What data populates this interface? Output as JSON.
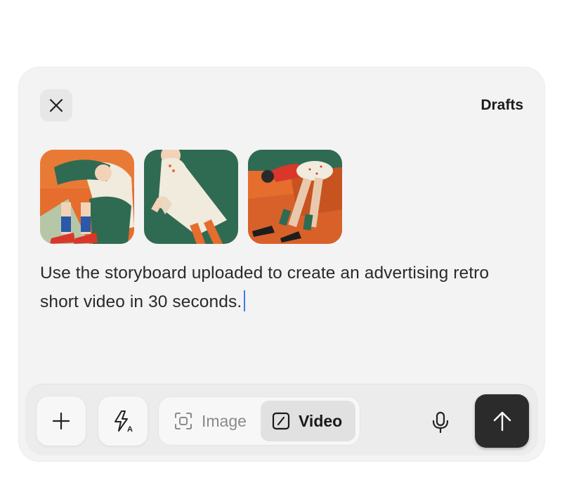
{
  "header": {
    "close_icon": "close-icon",
    "drafts_label": "Drafts"
  },
  "attachments": [
    {
      "name": "storyboard-image-1",
      "colors": [
        "#e56d2d",
        "#2f6b52",
        "#f1ebdd"
      ]
    },
    {
      "name": "storyboard-image-2",
      "colors": [
        "#2f6b52",
        "#f1ebdd",
        "#e56d2d"
      ]
    },
    {
      "name": "storyboard-image-3",
      "colors": [
        "#e56d2d",
        "#2f6b52",
        "#f1ebdd"
      ]
    }
  ],
  "prompt": {
    "text": "Use the storyboard uploaded to create an advertising retro short video in 30 seconds."
  },
  "toolbar": {
    "add_icon": "plus-icon",
    "magic_icon": "sparkle-bolt-icon",
    "modes": [
      {
        "label": "Image",
        "icon": "scan-image-icon",
        "selected": false
      },
      {
        "label": "Video",
        "icon": "video-frame-icon",
        "selected": true
      }
    ],
    "mic_icon": "microphone-icon",
    "send_icon": "arrow-up-icon"
  },
  "colors": {
    "accent_caret": "#3b7de8",
    "send_button": "#2b2b2b"
  }
}
